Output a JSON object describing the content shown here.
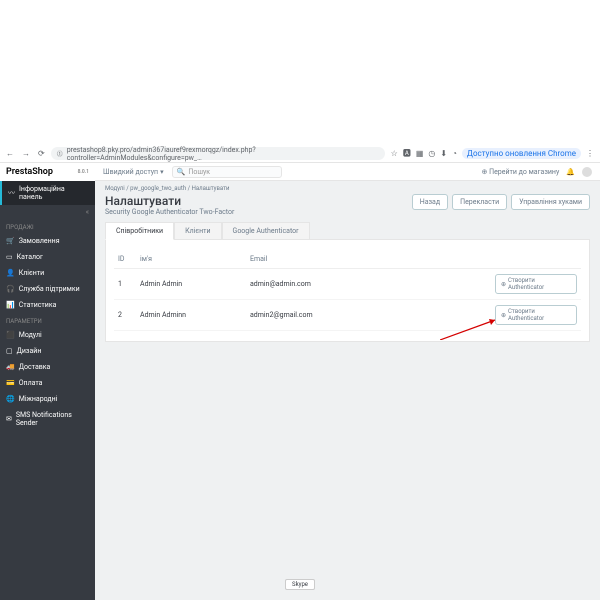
{
  "browser": {
    "url": "prestashop8.pky.pro/admin367iauref9rexmorqgz/index.php?controller=AdminModules&configure=pw_…",
    "update": "Доступно оновлення Chrome"
  },
  "logo": {
    "name": "PrestaShop",
    "ver": "8.0.1"
  },
  "topbar": {
    "quick": "Швидкий доступ",
    "search": "Пошук",
    "store": "Перейти до магазину"
  },
  "crumbs": {
    "a": "Модулі",
    "b": "pw_google_two_auth",
    "c": "Налаштувати"
  },
  "head": {
    "title": "Налаштувати",
    "sub": "Security Google Authenticator Two-Factor"
  },
  "btns": {
    "back": "Назад",
    "trans": "Перекласти",
    "hooks": "Управління хуками"
  },
  "tabs": {
    "emp": "Співробітники",
    "cli": "Клієнти",
    "ga": "Google Authenticator"
  },
  "table": {
    "h": {
      "id": "ID",
      "name": "ім'я",
      "email": "Email"
    },
    "rows": [
      {
        "id": "1",
        "name": "Admin Admin",
        "email": "admin@admin.com",
        "act": "Створити Authenticator"
      },
      {
        "id": "2",
        "name": "Admin Adminn",
        "email": "admin2@gmail.com",
        "act": "Створити Authenticator"
      }
    ]
  },
  "sidebar": {
    "dash": "Інформаційна панель",
    "g1": "ПРОДАЖІ",
    "orders": "Замовлення",
    "catalog": "Каталог",
    "customers": "Клієнти",
    "support": "Служба підтримки",
    "stats": "Статистика",
    "g2": "ПАРАМЕТРИ",
    "modules": "Модулі",
    "design": "Дизайн",
    "shipping": "Доставка",
    "payment": "Оплата",
    "intl": "Міжнародні",
    "sms": "SMS Notifications Sender"
  },
  "skype": "Skype"
}
